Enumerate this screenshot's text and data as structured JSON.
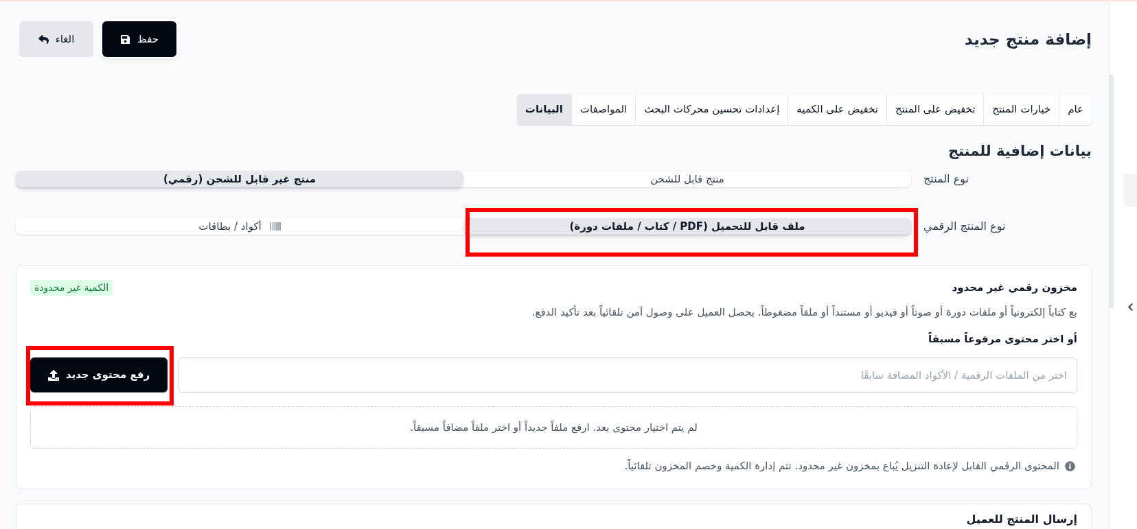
{
  "header": {
    "title": "إضافة منتج جديد",
    "actions": [
      {
        "kind": "save",
        "label": "حفظ"
      },
      {
        "kind": "cancel",
        "label": "الغاء"
      }
    ]
  },
  "tabs": [
    {
      "label": "عام",
      "selected": false
    },
    {
      "label": "خيارات المنتج",
      "selected": false
    },
    {
      "label": "تخفيض على المنتج",
      "selected": false
    },
    {
      "label": "تخفيض على الكميه",
      "selected": false
    },
    {
      "label": "إعدادات تحسين محركات البحث",
      "selected": false
    },
    {
      "label": "المواصفات",
      "selected": false
    },
    {
      "label": "البيانات",
      "selected": true
    }
  ],
  "section": {
    "title": "بيانات إضافية للمنتج"
  },
  "product_type": {
    "label": "نوع المنتج",
    "options": [
      {
        "label": "منتج قابل للشحن",
        "selected": false
      },
      {
        "label": "منتج غير قابل للشحن (رقمي)",
        "selected": true
      }
    ]
  },
  "digital_type": {
    "label": "نوع المنتج الرقمي",
    "options": [
      {
        "kind": "file",
        "label": "ملف قابل للتحميل (PDF / كتاب / ملفات دورة)",
        "selected": true,
        "highlighted": true
      },
      {
        "kind": "codes",
        "label": "أكواد / بطاقات",
        "selected": false,
        "highlighted": false
      }
    ]
  },
  "stock_card": {
    "title": "مخزون رقمي غير محدود",
    "badge": "الكمية غير محدودة",
    "description": "بع كتاباً إلكترونياً أو ملفات دورة أو صوتاً أو فيديو أو مستنداً أو ملفاً مضغوطاً. يحصل العميل على وصول آمن تلقائياً بعد تأكيد الدفع.",
    "picker_label": "أو اختر محتوى مرفوعاً مسبقاً",
    "picker": {
      "placeholder": "اختر من الملفات الرقمية / الأكواد المضافة سابقًا"
    },
    "upload_button": {
      "label": "رفع محتوى جديد",
      "highlighted": true
    },
    "empty_state": "لم يتم اختيار محتوى بعد. ارفع ملفاً جديداً أو اختر ملفاً مضافاً مسبقاً.",
    "note": "المحتوى الرقمي القابل لإعادة التنزيل يُباع بمخزون غير محدود. تتم إدارة الكمية وخصم المخزون تلقائياً."
  },
  "delivery_card": {
    "title": "إرسال المنتج للعميل"
  }
}
